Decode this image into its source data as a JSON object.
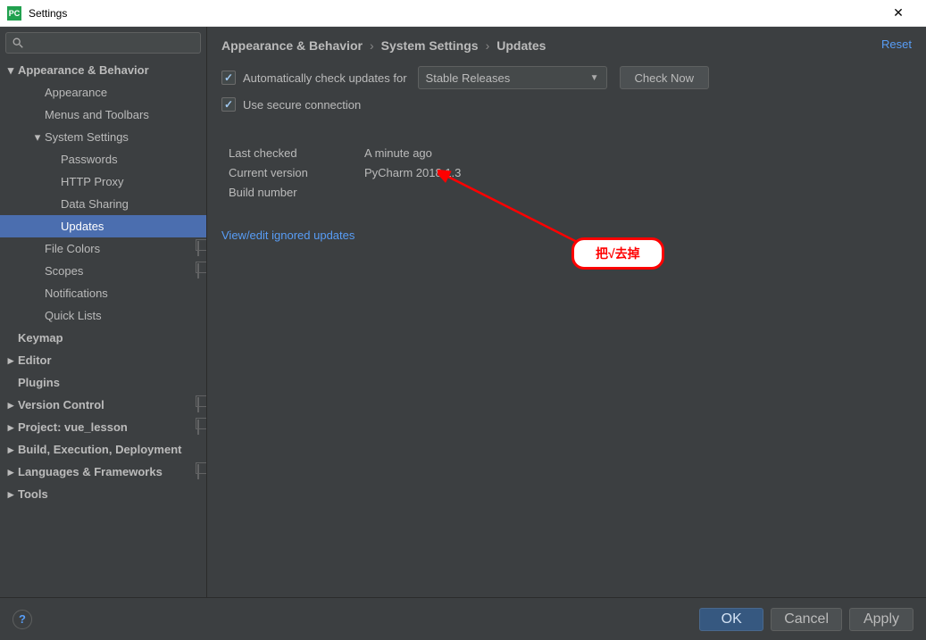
{
  "window": {
    "title": "Settings"
  },
  "breadcrumb": {
    "a": "Appearance & Behavior",
    "b": "System Settings",
    "c": "Updates"
  },
  "reset": "Reset",
  "form": {
    "auto_check_label": "Automatically check updates for",
    "channel": "Stable Releases",
    "check_now": "Check Now",
    "secure_label": "Use secure connection",
    "last_checked_label": "Last checked",
    "last_checked_value": "A minute ago",
    "current_version_label": "Current version",
    "current_version_value": "PyCharm 2018.1.3",
    "build_label": "Build number",
    "build_value": "",
    "ignored_link": "View/edit ignored updates"
  },
  "callout": "把√去掉",
  "sidebar": {
    "items": [
      {
        "label": "Appearance & Behavior",
        "lvl": 0,
        "bold": true,
        "arrow": "down"
      },
      {
        "label": "Appearance",
        "lvl": 1
      },
      {
        "label": "Menus and Toolbars",
        "lvl": 1
      },
      {
        "label": "System Settings",
        "lvl": 1,
        "arrow": "down"
      },
      {
        "label": "Passwords",
        "lvl": 2
      },
      {
        "label": "HTTP Proxy",
        "lvl": 2
      },
      {
        "label": "Data Sharing",
        "lvl": 2
      },
      {
        "label": "Updates",
        "lvl": 2,
        "selected": true
      },
      {
        "label": "File Colors",
        "lvl": 1,
        "copy": true
      },
      {
        "label": "Scopes",
        "lvl": 1,
        "copy": true
      },
      {
        "label": "Notifications",
        "lvl": 1
      },
      {
        "label": "Quick Lists",
        "lvl": 1
      },
      {
        "label": "Keymap",
        "lvl": 0,
        "bold": true
      },
      {
        "label": "Editor",
        "lvl": 0,
        "bold": true,
        "arrow": "right"
      },
      {
        "label": "Plugins",
        "lvl": 0,
        "bold": true
      },
      {
        "label": "Version Control",
        "lvl": 0,
        "bold": true,
        "arrow": "right",
        "copy": true
      },
      {
        "label": "Project: vue_lesson",
        "lvl": 0,
        "bold": true,
        "arrow": "right",
        "copy": true
      },
      {
        "label": "Build, Execution, Deployment",
        "lvl": 0,
        "bold": true,
        "arrow": "right"
      },
      {
        "label": "Languages & Frameworks",
        "lvl": 0,
        "bold": true,
        "arrow": "right",
        "copy": true
      },
      {
        "label": "Tools",
        "lvl": 0,
        "bold": true,
        "arrow": "right"
      }
    ]
  },
  "footer": {
    "ok": "OK",
    "cancel": "Cancel",
    "apply": "Apply"
  }
}
